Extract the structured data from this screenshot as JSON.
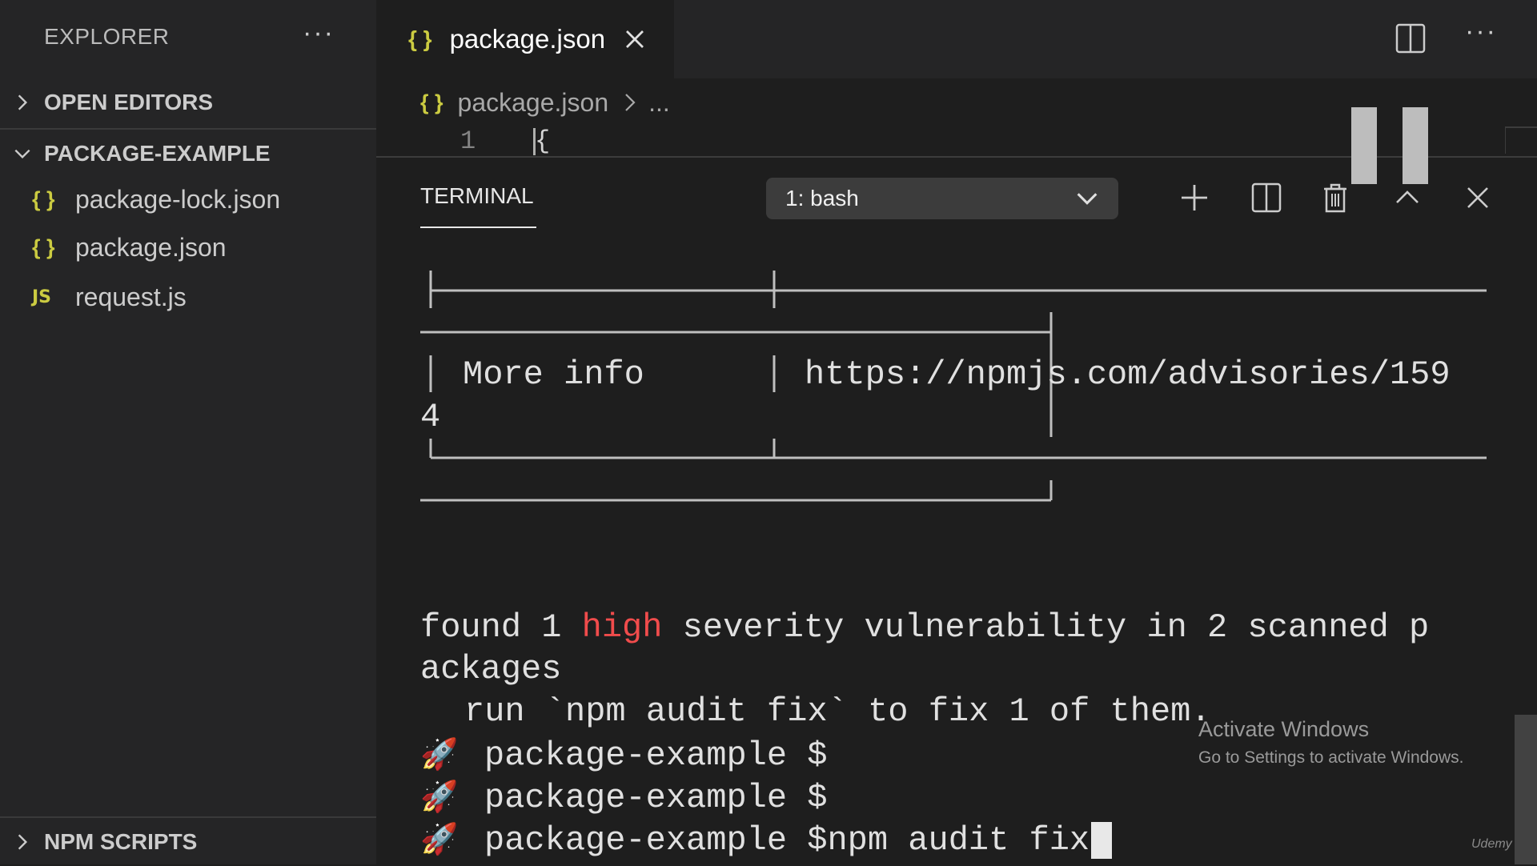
{
  "sidebar": {
    "title": "EXPLORER",
    "more": "···",
    "open_editors": "OPEN EDITORS",
    "project": "PACKAGE-EXAMPLE",
    "files": [
      {
        "name": "package-lock.json",
        "icon": "{ }"
      },
      {
        "name": "package.json",
        "icon": "{ }"
      },
      {
        "name": "request.js",
        "icon": "JS"
      }
    ],
    "npm_scripts": "NPM SCRIPTS"
  },
  "tab": {
    "icon": "{ }",
    "label": "package.json"
  },
  "tabbar_more": "···",
  "breadcrumb": {
    "icon": "{ }",
    "file": "package.json",
    "more": "..."
  },
  "editor": {
    "line_number": "1",
    "code": "{"
  },
  "panel": {
    "tab": "TERMINAL",
    "selected_terminal": "1: bash"
  },
  "terminal": {
    "more_info_label": "More info",
    "url": "https://npmjs.com/advisories/159",
    "url_wrap": "4",
    "found_prefix": "found 1 ",
    "found_high": "high",
    "found_suffix": " severity vulnerability in 2 scanned p",
    "found_wrap": "ackages",
    "run_line": "run `npm audit fix` to fix 1 of them.",
    "rocket": "🚀",
    "prompt1": "package-example $",
    "prompt2": "package-example $",
    "prompt3": "package-example $npm audit fix"
  },
  "watermark": {
    "title": "Activate Windows",
    "subtitle": "Go to Settings to activate Windows."
  },
  "brand": "Udemy",
  "colors": {
    "accent_json": "#cbcb41",
    "high": "#f14c4c",
    "background": "#1e1e1e"
  }
}
